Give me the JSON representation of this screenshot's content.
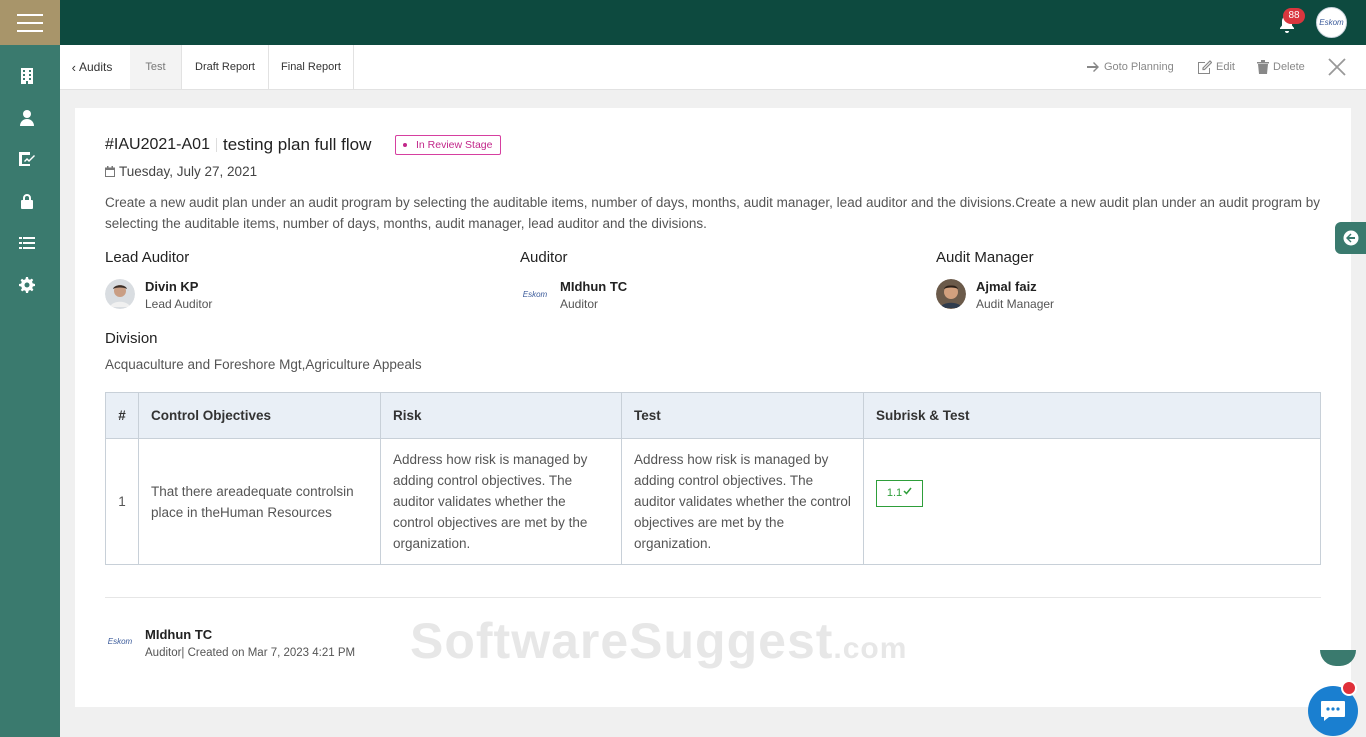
{
  "topbar": {
    "notifications_count": "88",
    "user_avatar_text": "Eskom"
  },
  "tabs": {
    "back_label": "Audits",
    "items": [
      {
        "label": "Test"
      },
      {
        "label": "Draft Report"
      },
      {
        "label": "Final Report"
      }
    ]
  },
  "actions": {
    "planning": "Goto Planning",
    "edit": "Edit",
    "delete": "Delete"
  },
  "plan": {
    "id": "#IAU2021-A01",
    "title": "testing plan full flow",
    "stage": "In Review Stage",
    "date": "Tuesday, July 27, 2021",
    "description": "Create a new audit plan under an audit program by selecting the auditable items, number of days, months, audit manager, lead auditor and the divisions.Create a new audit plan under an audit program by selecting the auditable items, number of days, months, audit manager, lead auditor and the divisions."
  },
  "people": {
    "lead": {
      "section": "Lead Auditor",
      "name": "Divin KP",
      "role": "Lead Auditor"
    },
    "auditor": {
      "section": "Auditor",
      "name": "MIdhun TC",
      "role": "Auditor",
      "avatar_text": "Eskom"
    },
    "manager": {
      "section": "Audit Manager",
      "name": "Ajmal faiz",
      "role": "Audit Manager"
    }
  },
  "division": {
    "label": "Division",
    "value": "Acquaculture and Foreshore Mgt,Agriculture Appeals"
  },
  "table": {
    "headers": [
      "#",
      "Control Objectives",
      "Risk",
      "Test",
      "Subrisk & Test"
    ],
    "rows": [
      {
        "num": "1",
        "objective": "That there areadequate controlsin place in theHuman Resources",
        "risk": "Address how risk is managed by adding control objectives. The auditor validates whether the control objectives are met by the organization.",
        "test": "Address how risk is managed by adding control objectives. The auditor validates whether the control objectives are met by the organization.",
        "subrisk": "1.1"
      }
    ]
  },
  "footer": {
    "name": "MIdhun TC",
    "meta": "Auditor| Created on Mar 7, 2023 4:21 PM",
    "avatar_text": "Eskom"
  },
  "watermark": {
    "main": "SoftwareSuggest",
    "suffix": ".com"
  },
  "colors": {
    "topbar": "#0d4a3f",
    "sidebar": "#3a7a6e",
    "menu": "#a8956a",
    "stage": "#c2278a",
    "subrisk": "#2e9e3a"
  }
}
